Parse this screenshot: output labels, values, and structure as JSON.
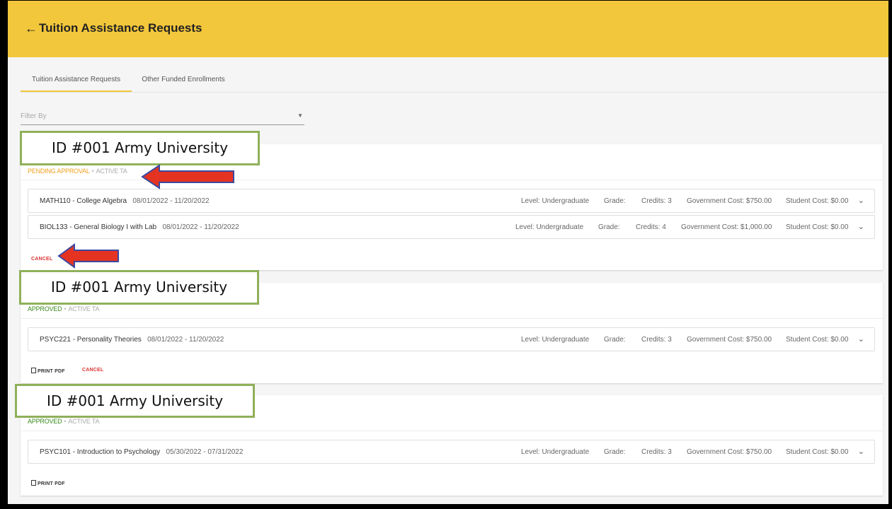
{
  "header": {
    "back_icon": "arrow-left-icon",
    "title": "Tuition Assistance Requests"
  },
  "tabs": [
    {
      "label": "Tuition Assistance Requests",
      "active": true
    },
    {
      "label": "Other Funded Enrollments",
      "active": false
    }
  ],
  "filter": {
    "label": "Filter By"
  },
  "callout_text": "ID #001 Army University",
  "requests": [
    {
      "status": "PENDING APPROVAL",
      "status_color": "#f0a020",
      "secondary": "ACTIVE TA",
      "courses": [
        {
          "name": "MATH110 - College Algebra",
          "dates": "08/01/2022 - 11/20/2022",
          "level": "Level: Undergraduate",
          "grade": "Grade:",
          "credits": "Credits: 3",
          "gov_cost": "Government Cost: $750.00",
          "student_cost": "Student Cost: $0.00"
        },
        {
          "name": "BIOL133 - General Biology I with Lab",
          "dates": "08/01/2022 - 11/20/2022",
          "level": "Level: Undergraduate",
          "grade": "Grade:",
          "credits": "Credits: 4",
          "gov_cost": "Government Cost: $1,000.00",
          "student_cost": "Student Cost: $0.00"
        }
      ],
      "actions": {
        "cancel": "CANCEL"
      }
    },
    {
      "status": "APPROVED",
      "status_color": "#3a8a1e",
      "secondary": "ACTIVE TA",
      "courses": [
        {
          "name": "PSYC221 - Personality Theories",
          "dates": "08/01/2022 - 11/20/2022",
          "level": "Level: Undergraduate",
          "grade": "Grade:",
          "credits": "Credits: 3",
          "gov_cost": "Government Cost: $750.00",
          "student_cost": "Student Cost: $0.00"
        }
      ],
      "actions": {
        "print": "PRINT PDF",
        "cancel": "CANCEL"
      }
    },
    {
      "status": "APPROVED",
      "status_color": "#3a8a1e",
      "secondary": "ACTIVE TA",
      "courses": [
        {
          "name": "PSYC101 - Introduction to Psychology",
          "dates": "05/30/2022 - 07/31/2022",
          "level": "Level: Undergraduate",
          "grade": "Grade:",
          "credits": "Credits: 3",
          "gov_cost": "Government Cost: $750.00",
          "student_cost": "Student Cost: $0.00"
        }
      ],
      "actions": {
        "print": "PRINT PDF"
      }
    }
  ],
  "colors": {
    "header": "#f3c73b",
    "callout_border": "#8fb05a",
    "arrow_fill": "#e53322",
    "arrow_outline": "#3b4aa0",
    "cancel": "#d33333"
  }
}
